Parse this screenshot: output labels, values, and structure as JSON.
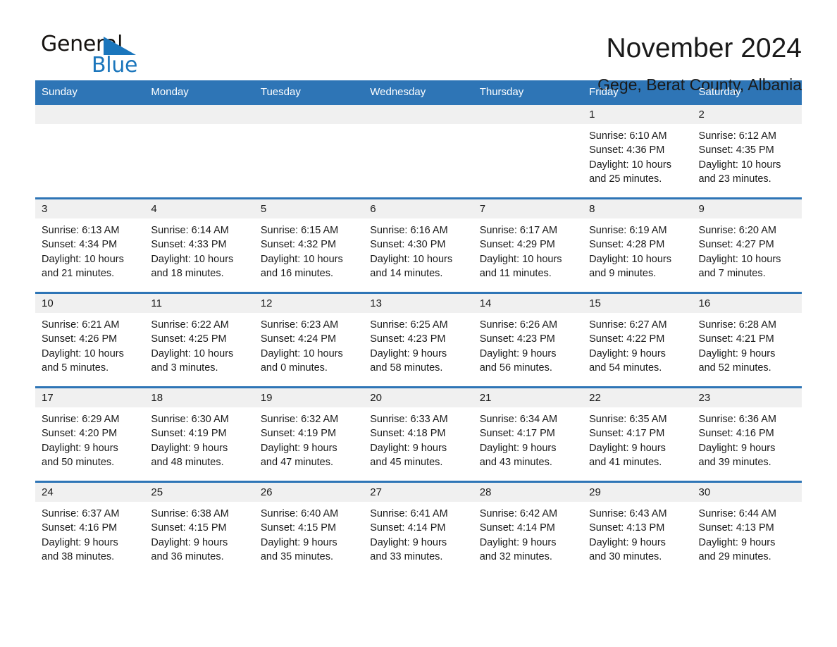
{
  "logo": {
    "word_one": "General",
    "word_two": "Blue",
    "triangle_color": "#1b76bc"
  },
  "header": {
    "title": "November 2024",
    "subtitle": "Gege, Berat County, Albania"
  },
  "theme": {
    "header_blue": "#2e75b6",
    "daynum_band": "#f0f0f0",
    "text": "#1a1a1a"
  },
  "calendar": {
    "weekdays": [
      "Sunday",
      "Monday",
      "Tuesday",
      "Wednesday",
      "Thursday",
      "Friday",
      "Saturday"
    ],
    "weeks": [
      [
        {
          "day": "",
          "lines": []
        },
        {
          "day": "",
          "lines": []
        },
        {
          "day": "",
          "lines": []
        },
        {
          "day": "",
          "lines": []
        },
        {
          "day": "",
          "lines": []
        },
        {
          "day": "1",
          "lines": [
            "Sunrise: 6:10 AM",
            "Sunset: 4:36 PM",
            "Daylight: 10 hours",
            "and 25 minutes."
          ]
        },
        {
          "day": "2",
          "lines": [
            "Sunrise: 6:12 AM",
            "Sunset: 4:35 PM",
            "Daylight: 10 hours",
            "and 23 minutes."
          ]
        }
      ],
      [
        {
          "day": "3",
          "lines": [
            "Sunrise: 6:13 AM",
            "Sunset: 4:34 PM",
            "Daylight: 10 hours",
            "and 21 minutes."
          ]
        },
        {
          "day": "4",
          "lines": [
            "Sunrise: 6:14 AM",
            "Sunset: 4:33 PM",
            "Daylight: 10 hours",
            "and 18 minutes."
          ]
        },
        {
          "day": "5",
          "lines": [
            "Sunrise: 6:15 AM",
            "Sunset: 4:32 PM",
            "Daylight: 10 hours",
            "and 16 minutes."
          ]
        },
        {
          "day": "6",
          "lines": [
            "Sunrise: 6:16 AM",
            "Sunset: 4:30 PM",
            "Daylight: 10 hours",
            "and 14 minutes."
          ]
        },
        {
          "day": "7",
          "lines": [
            "Sunrise: 6:17 AM",
            "Sunset: 4:29 PM",
            "Daylight: 10 hours",
            "and 11 minutes."
          ]
        },
        {
          "day": "8",
          "lines": [
            "Sunrise: 6:19 AM",
            "Sunset: 4:28 PM",
            "Daylight: 10 hours",
            "and 9 minutes."
          ]
        },
        {
          "day": "9",
          "lines": [
            "Sunrise: 6:20 AM",
            "Sunset: 4:27 PM",
            "Daylight: 10 hours",
            "and 7 minutes."
          ]
        }
      ],
      [
        {
          "day": "10",
          "lines": [
            "Sunrise: 6:21 AM",
            "Sunset: 4:26 PM",
            "Daylight: 10 hours",
            "and 5 minutes."
          ]
        },
        {
          "day": "11",
          "lines": [
            "Sunrise: 6:22 AM",
            "Sunset: 4:25 PM",
            "Daylight: 10 hours",
            "and 3 minutes."
          ]
        },
        {
          "day": "12",
          "lines": [
            "Sunrise: 6:23 AM",
            "Sunset: 4:24 PM",
            "Daylight: 10 hours",
            "and 0 minutes."
          ]
        },
        {
          "day": "13",
          "lines": [
            "Sunrise: 6:25 AM",
            "Sunset: 4:23 PM",
            "Daylight: 9 hours",
            "and 58 minutes."
          ]
        },
        {
          "day": "14",
          "lines": [
            "Sunrise: 6:26 AM",
            "Sunset: 4:23 PM",
            "Daylight: 9 hours",
            "and 56 minutes."
          ]
        },
        {
          "day": "15",
          "lines": [
            "Sunrise: 6:27 AM",
            "Sunset: 4:22 PM",
            "Daylight: 9 hours",
            "and 54 minutes."
          ]
        },
        {
          "day": "16",
          "lines": [
            "Sunrise: 6:28 AM",
            "Sunset: 4:21 PM",
            "Daylight: 9 hours",
            "and 52 minutes."
          ]
        }
      ],
      [
        {
          "day": "17",
          "lines": [
            "Sunrise: 6:29 AM",
            "Sunset: 4:20 PM",
            "Daylight: 9 hours",
            "and 50 minutes."
          ]
        },
        {
          "day": "18",
          "lines": [
            "Sunrise: 6:30 AM",
            "Sunset: 4:19 PM",
            "Daylight: 9 hours",
            "and 48 minutes."
          ]
        },
        {
          "day": "19",
          "lines": [
            "Sunrise: 6:32 AM",
            "Sunset: 4:19 PM",
            "Daylight: 9 hours",
            "and 47 minutes."
          ]
        },
        {
          "day": "20",
          "lines": [
            "Sunrise: 6:33 AM",
            "Sunset: 4:18 PM",
            "Daylight: 9 hours",
            "and 45 minutes."
          ]
        },
        {
          "day": "21",
          "lines": [
            "Sunrise: 6:34 AM",
            "Sunset: 4:17 PM",
            "Daylight: 9 hours",
            "and 43 minutes."
          ]
        },
        {
          "day": "22",
          "lines": [
            "Sunrise: 6:35 AM",
            "Sunset: 4:17 PM",
            "Daylight: 9 hours",
            "and 41 minutes."
          ]
        },
        {
          "day": "23",
          "lines": [
            "Sunrise: 6:36 AM",
            "Sunset: 4:16 PM",
            "Daylight: 9 hours",
            "and 39 minutes."
          ]
        }
      ],
      [
        {
          "day": "24",
          "lines": [
            "Sunrise: 6:37 AM",
            "Sunset: 4:16 PM",
            "Daylight: 9 hours",
            "and 38 minutes."
          ]
        },
        {
          "day": "25",
          "lines": [
            "Sunrise: 6:38 AM",
            "Sunset: 4:15 PM",
            "Daylight: 9 hours",
            "and 36 minutes."
          ]
        },
        {
          "day": "26",
          "lines": [
            "Sunrise: 6:40 AM",
            "Sunset: 4:15 PM",
            "Daylight: 9 hours",
            "and 35 minutes."
          ]
        },
        {
          "day": "27",
          "lines": [
            "Sunrise: 6:41 AM",
            "Sunset: 4:14 PM",
            "Daylight: 9 hours",
            "and 33 minutes."
          ]
        },
        {
          "day": "28",
          "lines": [
            "Sunrise: 6:42 AM",
            "Sunset: 4:14 PM",
            "Daylight: 9 hours",
            "and 32 minutes."
          ]
        },
        {
          "day": "29",
          "lines": [
            "Sunrise: 6:43 AM",
            "Sunset: 4:13 PM",
            "Daylight: 9 hours",
            "and 30 minutes."
          ]
        },
        {
          "day": "30",
          "lines": [
            "Sunrise: 6:44 AM",
            "Sunset: 4:13 PM",
            "Daylight: 9 hours",
            "and 29 minutes."
          ]
        }
      ]
    ]
  }
}
